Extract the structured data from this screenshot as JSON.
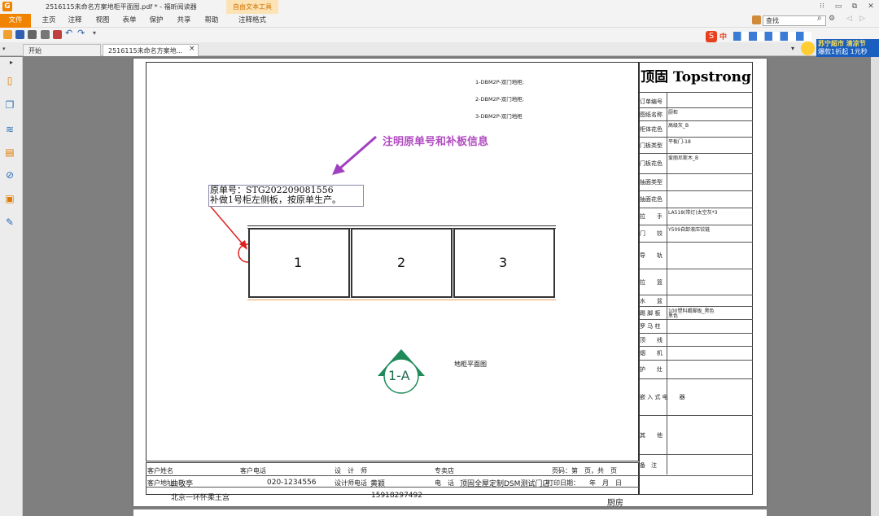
{
  "window": {
    "title": "2516115未命名方案地柜平面图.pdf * - 福昕阅读器",
    "context_tab_group": "自由文本工具",
    "app_logo": "G"
  },
  "menu": {
    "items": [
      "文件",
      "主页",
      "注释",
      "视图",
      "表单",
      "保护",
      "共享",
      "帮助",
      "注释格式"
    ],
    "search_placeholder": "查找"
  },
  "tabs": [
    {
      "label": "开始"
    },
    {
      "label": "2516115未命名方案地...",
      "close": "×"
    }
  ],
  "ad": {
    "line1": "苏宁超市 清凉节",
    "line2": "爆款1折起 1元秒"
  },
  "sogou": {
    "label": "中"
  },
  "drawing": {
    "legend": [
      "1-DBM2P-双门地柜;",
      "2-DBM2P-双门地柜;",
      "3-DBM2P-双门地柜"
    ],
    "annotation_label": "注明原单号和补板信息",
    "note_line1": "原单号：STG202209081556",
    "note_line2": "补做1号柜左侧板，按原单生产。",
    "cabinets": [
      "1",
      "2",
      "3"
    ],
    "view_marker": "1-A",
    "view_title": "地柜平面图"
  },
  "title_block": {
    "brand": "顶固 Topstrong",
    "rows": [
      {
        "label": "订单编号",
        "value": ""
      },
      {
        "label": "图纸名称",
        "value": "厨柜"
      },
      {
        "label": "柜体花色",
        "value": "高级灰_B"
      },
      {
        "label": "门板类型",
        "value": "平板门-18"
      },
      {
        "label": "门板花色",
        "value": "爱丽尼斯木_B"
      },
      {
        "label": "抽面类型",
        "value": ""
      },
      {
        "label": "抽面花色",
        "value": ""
      },
      {
        "label": "拉　　手",
        "value": "LA518(带灯)太空灰*3"
      },
      {
        "label": "门　　铰",
        "value": "Y509自卸液压铰链"
      },
      {
        "label": "导　　轨",
        "value": ""
      },
      {
        "label": "拉　　篮",
        "value": ""
      },
      {
        "label": "水　　盆",
        "value": ""
      },
      {
        "label": "踢 脚 板",
        "value": "100塑料踢脚板_黑色"
      },
      {
        "label": "罗 马 柱",
        "value": ""
      },
      {
        "label": "顶　　线",
        "value": ""
      },
      {
        "label": "烟　　机",
        "value": ""
      },
      {
        "label": "护　　灶",
        "value": ""
      },
      {
        "label": "嵌 入 式 电　　器",
        "value": ""
      },
      {
        "label": "其　　他",
        "value": ""
      },
      {
        "label": "备　注",
        "value": ""
      }
    ],
    "kick_board_sub": "黑色"
  },
  "bottom": {
    "customer_name_label": "客户姓名",
    "customer_name": "",
    "customer_phone_label": "客户电话",
    "customer_phone": "020-1234556",
    "designer_label": "设　计　师",
    "designer": "黄颖",
    "store_label": "专卖店",
    "store": "顶固全屋定制DSM测试门店",
    "page_label": "页码：第　页，共　页",
    "address_label": "客户地址",
    "address": "北京一环怀柔王宫",
    "designer_phone_label": "设计师电话",
    "designer_phone": "15918297492",
    "phone_label": "电　话",
    "print_date_label": "打印日期：　　年　月　日",
    "signer": "曲敬亭",
    "room": "厨房"
  }
}
